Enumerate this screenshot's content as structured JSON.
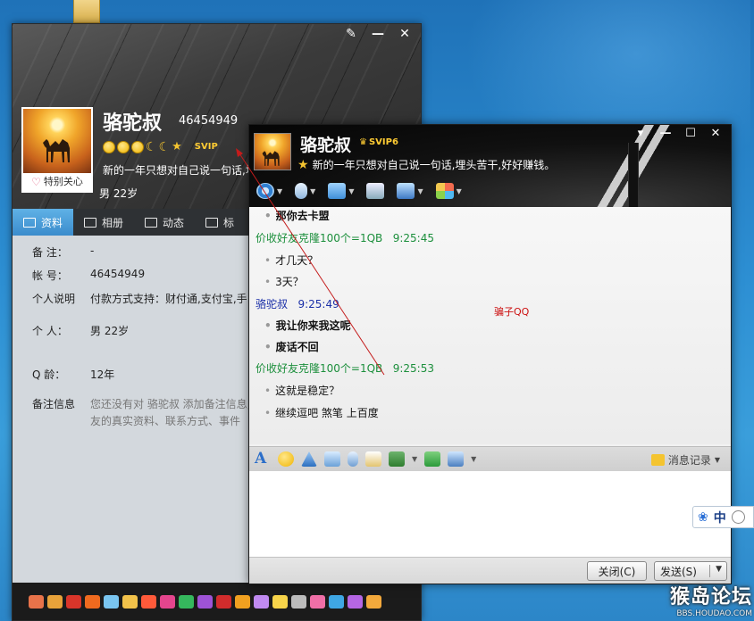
{
  "profile_window": {
    "name": "骆驼叔",
    "qq_number": "46454949",
    "signature": "新的一年只想对自己说一句话,埋",
    "sex_age": "男   22岁",
    "special_care": "特别关心",
    "svip": "SVIP",
    "window_buttons": {
      "skin": "✎",
      "minimize": "—",
      "close": "✕"
    },
    "tabs": [
      {
        "label": "资料",
        "icon": "profile-card-icon"
      },
      {
        "label": "相册",
        "icon": "photo-album-icon"
      },
      {
        "label": "动态",
        "icon": "feed-list-icon"
      },
      {
        "label": "标",
        "icon": "bookmark-icon"
      }
    ],
    "info": [
      {
        "key": "备    注：",
        "value": "-"
      },
      {
        "key": "帐    号：",
        "value": "46454949"
      },
      {
        "key": "个人说明",
        "value": "付款方式支持：财付通,支付宝,手"
      },
      {
        "key": "个    人：",
        "value": "男   22岁"
      },
      {
        "key": "Q     龄：",
        "value": "12年"
      },
      {
        "key": "备注信息",
        "value": "您还没有对 骆驼叔 添加备注信息,友的真实资料、联系方式、事件"
      }
    ]
  },
  "chat_window": {
    "name": "骆驼叔",
    "svip": "SVIP6",
    "signature": "新的一年只想对自己说一句话,埋头苦干,好好赚钱。",
    "window_buttons": {
      "menu": "▾",
      "minimize": "—",
      "maximize": "☐",
      "close": "✕"
    },
    "messages": [
      {
        "type": "body",
        "text": "那你去卡盟",
        "bold": true
      },
      {
        "type": "header",
        "sender": "价收好友克隆100个=1QB",
        "time": "9:25:45"
      },
      {
        "type": "body",
        "text": "才几天？",
        "bold": false
      },
      {
        "type": "body",
        "text": "3天？",
        "bold": false
      },
      {
        "type": "header_self",
        "sender": "骆驼叔",
        "time": "9:25:49"
      },
      {
        "type": "body",
        "text": "我让你来我这呢",
        "bold": true
      },
      {
        "type": "body",
        "text": "废话不回",
        "bold": true
      },
      {
        "type": "header",
        "sender": "价收好友克隆100个=1QB",
        "time": "9:25:53"
      },
      {
        "type": "body",
        "text": "这就是稳定？",
        "bold": false
      },
      {
        "type": "body",
        "text": "继续逗吧 煞笔 上百度",
        "bold": false
      }
    ],
    "annotation": "骗子QQ",
    "history_label": "消息记录",
    "close_button": "关闭(C)",
    "send_button": "发送(S)"
  },
  "ime": {
    "mode": "中"
  },
  "watermark": {
    "main": "猴岛论坛",
    "url": "BBS.HOUDAO.COM"
  },
  "colors": {
    "sender_other": "#1c8f3c",
    "sender_self": "#1a2fa8",
    "annotation": "#cc1111",
    "active_tab": "#3b8ccc"
  }
}
